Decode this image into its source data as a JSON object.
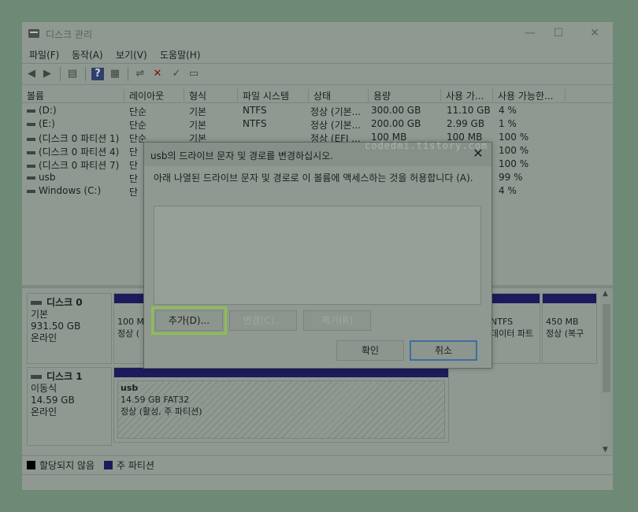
{
  "window": {
    "title": "디스크 관리",
    "controls": {
      "minimize": "—",
      "maximize": "☐",
      "close": "✕"
    }
  },
  "menu": [
    "파일(F)",
    "동작(A)",
    "보기(V)",
    "도움말(H)"
  ],
  "toolbar_icons": [
    "back-arrow-icon",
    "forward-arrow-icon",
    "disk-list-icon",
    "help-icon",
    "properties-icon",
    "connect-icon",
    "delete-icon",
    "check-icon",
    "info-icon"
  ],
  "volume_table": {
    "headers": [
      "볼륨",
      "레이아웃",
      "형식",
      "파일 시스템",
      "상태",
      "용량",
      "사용 가...",
      "사용 가능한..."
    ],
    "rows": [
      [
        "(D:)",
        "단순",
        "기본",
        "NTFS",
        "정상 (기본...",
        "300.00 GB",
        "11.10 GB",
        "4 %"
      ],
      [
        "(E:)",
        "단순",
        "기본",
        "NTFS",
        "정상 (기본...",
        "200.00 GB",
        "2.99 GB",
        "1 %"
      ],
      [
        "(디스크 0 파티션 1)",
        "단순",
        "기본",
        "",
        "정상 (EFI ...",
        "100 MB",
        "100 MB",
        "100 %"
      ],
      [
        "(디스크 0 파티션 4)",
        "단",
        "",
        "",
        "",
        "",
        "",
        "100 %"
      ],
      [
        "(디스크 0 파티션 7)",
        "단",
        "",
        "",
        "",
        "",
        "",
        "100 %"
      ],
      [
        "usb",
        "단",
        "",
        "",
        "",
        "",
        "",
        "99 %"
      ],
      [
        "Windows (C:)",
        "단",
        "",
        "",
        "",
        "",
        "",
        "4 %"
      ]
    ]
  },
  "disks": [
    {
      "name": "디스크 0",
      "type": "기본",
      "size": "931.50 GB",
      "status": "온라인",
      "partitions": [
        {
          "line1": "100 M",
          "line2": "정상 ("
        },
        {
          "line1": "NTFS",
          "line2": "데이터 파트"
        },
        {
          "line1": "450 MB",
          "line2": "정상 (복구"
        }
      ]
    },
    {
      "name": "디스크 1",
      "type": "이동식",
      "size": "14.59 GB",
      "status": "온라인",
      "partitions": [
        {
          "line0": "usb",
          "line1": "14.59 GB FAT32",
          "line2": "정상 (활성, 주 파티션)"
        }
      ]
    }
  ],
  "legend": [
    {
      "label": "할당되지 않음",
      "color": "#000000"
    },
    {
      "label": "주 파티션",
      "color": "#1e1a5c"
    }
  ],
  "dialog": {
    "title": "usb의 드라이브 문자 및 경로를 변경하십시오.",
    "watermark": "codedmi.tistory.com",
    "description": "아래 나열된 드라이브 문자 및 경로로 이 볼륨에 액세스하는 것을 허용합니다 (A).",
    "buttons": {
      "add": "추가(D)...",
      "change": "변경(C)...",
      "remove": "제거(R)",
      "ok": "확인",
      "cancel": "취소"
    }
  }
}
